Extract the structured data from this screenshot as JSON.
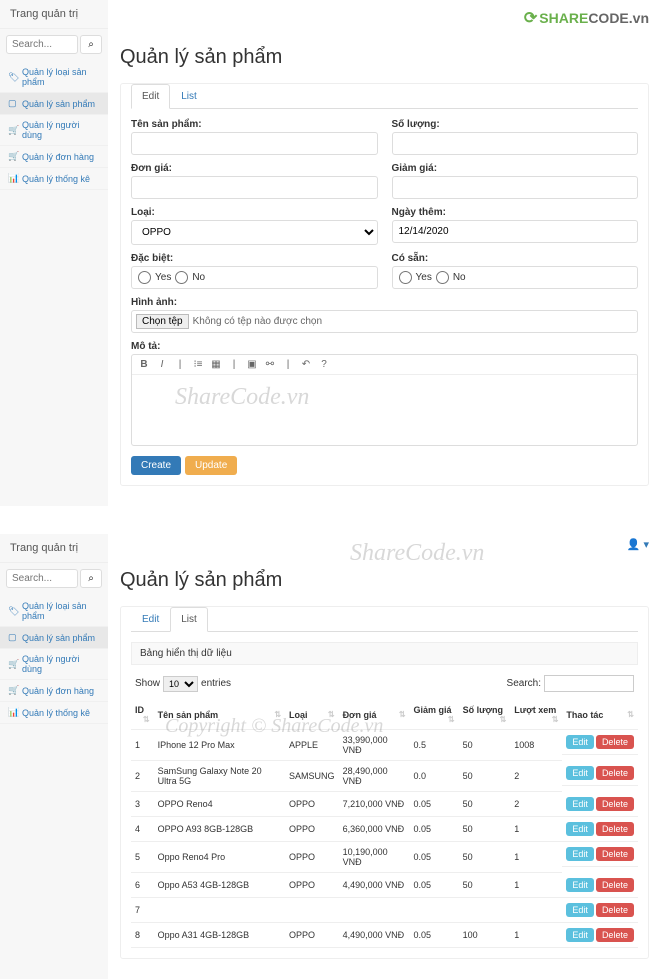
{
  "brand": {
    "swirl": "⟳",
    "share": "SHARE",
    "code": "CODE",
    "tld": ".vn"
  },
  "sidebar": {
    "title": "Trang quản trị",
    "search_placeholder": "Search...",
    "search_icon": "⌕",
    "items": [
      {
        "icon": "🏷",
        "label": "Quản lý loại sản phẩm"
      },
      {
        "icon": "▢",
        "label": "Quản lý sản phẩm"
      },
      {
        "icon": "🛒",
        "label": "Quản lý người dùng"
      },
      {
        "icon": "🛒",
        "label": "Quản lý đơn hàng"
      },
      {
        "icon": "📊",
        "label": "Quản lý thống kê"
      }
    ]
  },
  "page_title": "Quản lý sản phẩm",
  "tabs": {
    "edit": "Edit",
    "list": "List"
  },
  "form": {
    "ten_sp": "Tên sản phẩm:",
    "so_luong": "Số lượng:",
    "don_gia": "Đơn giá:",
    "giam_gia": "Giảm giá:",
    "loai": "Loại:",
    "loai_value": "OPPO",
    "ngay_them": "Ngày thêm:",
    "ngay_them_value": "12/14/2020",
    "dac_biet": "Đặc biệt:",
    "co_san": "Có sẵn:",
    "yes": "Yes",
    "no": "No",
    "hinh_anh": "Hình ảnh:",
    "file_btn": "Chọn tệp",
    "file_text": "Không có tệp nào được chọn",
    "mo_ta": "Mô tả:",
    "create": "Create",
    "update": "Update"
  },
  "user_indicator": "👤 ▾",
  "list": {
    "header": "Bảng hiển thị dữ liệu",
    "show": "Show",
    "entries": "entries",
    "pagesize": "10",
    "search_label": "Search:",
    "columns": [
      "ID",
      "Tên sản phẩm",
      "Loại",
      "Đơn giá",
      "Giảm giá",
      "Số lượng",
      "Lượt xem",
      "Thao tác"
    ],
    "sort_glyph": "⇅",
    "edit_btn": "Edit",
    "delete_btn": "Delete",
    "rows": [
      {
        "id": "1",
        "ten": "IPhone 12 Pro Max",
        "loai": "APPLE",
        "gia": "33,990,000 VNĐ",
        "giam": "0.5",
        "sl": "50",
        "view": "1008"
      },
      {
        "id": "2",
        "ten": "SamSung Galaxy Note 20 Ultra 5G",
        "loai": "SAMSUNG",
        "gia": "28,490,000 VNĐ",
        "giam": "0.0",
        "sl": "50",
        "view": "2"
      },
      {
        "id": "3",
        "ten": "OPPO Reno4",
        "loai": "OPPO",
        "gia": "7,210,000 VNĐ",
        "giam": "0.05",
        "sl": "50",
        "view": "2"
      },
      {
        "id": "4",
        "ten": "OPPO A93 8GB-128GB",
        "loai": "OPPO",
        "gia": "6,360,000 VNĐ",
        "giam": "0.05",
        "sl": "50",
        "view": "1"
      },
      {
        "id": "5",
        "ten": "Oppo Reno4 Pro",
        "loai": "OPPO",
        "gia": "10,190,000 VNĐ",
        "giam": "0.05",
        "sl": "50",
        "view": "1"
      },
      {
        "id": "6",
        "ten": "Oppo A53 4GB-128GB",
        "loai": "OPPO",
        "gia": "4,490,000 VNĐ",
        "giam": "0.05",
        "sl": "50",
        "view": "1"
      },
      {
        "id": "7",
        "ten": "",
        "loai": "",
        "gia": "",
        "giam": "",
        "sl": "",
        "view": ""
      },
      {
        "id": "8",
        "ten": "Oppo A31 4GB-128GB",
        "loai": "OPPO",
        "gia": "4,490,000 VNĐ",
        "giam": "0.05",
        "sl": "100",
        "view": "1"
      }
    ]
  },
  "watermarks": {
    "w1": "ShareCode.vn",
    "w2": "ShareCode.vn",
    "w3": "Copyright © ShareCode.vn"
  }
}
